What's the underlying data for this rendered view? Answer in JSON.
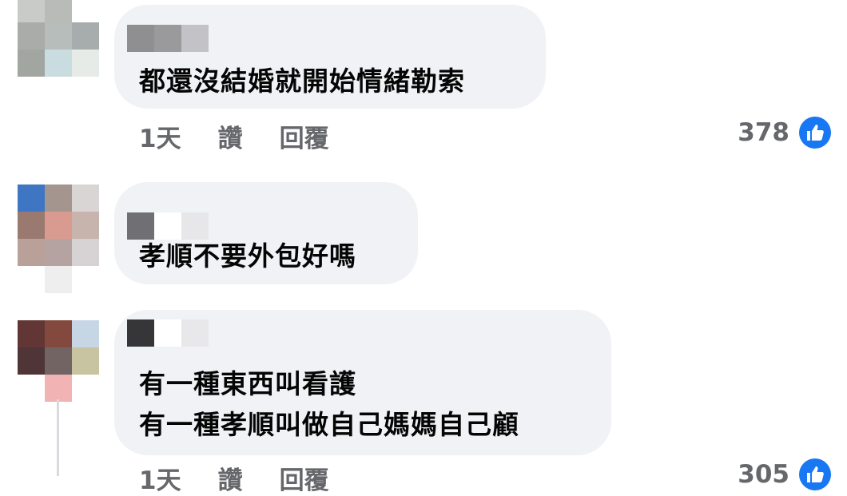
{
  "comments": [
    {
      "text": "都還沒結婚就開始情緒勒索",
      "time": "1天",
      "like_label": "讚",
      "reply_label": "回覆",
      "like_count": "378"
    },
    {
      "text": "孝順不要外包好嗎"
    },
    {
      "text_line1": "有一種東西叫看護",
      "text_line2": "有一種孝順叫做自己媽媽自己顧",
      "time": "1天",
      "like_label": "讚",
      "reply_label": "回覆",
      "like_count": "305"
    }
  ],
  "colors": {
    "bubble": "#f0f2f5",
    "meta_text": "#65676b",
    "like_blue": "#1877f2"
  },
  "icons": [
    "thumbs-up-icon"
  ]
}
